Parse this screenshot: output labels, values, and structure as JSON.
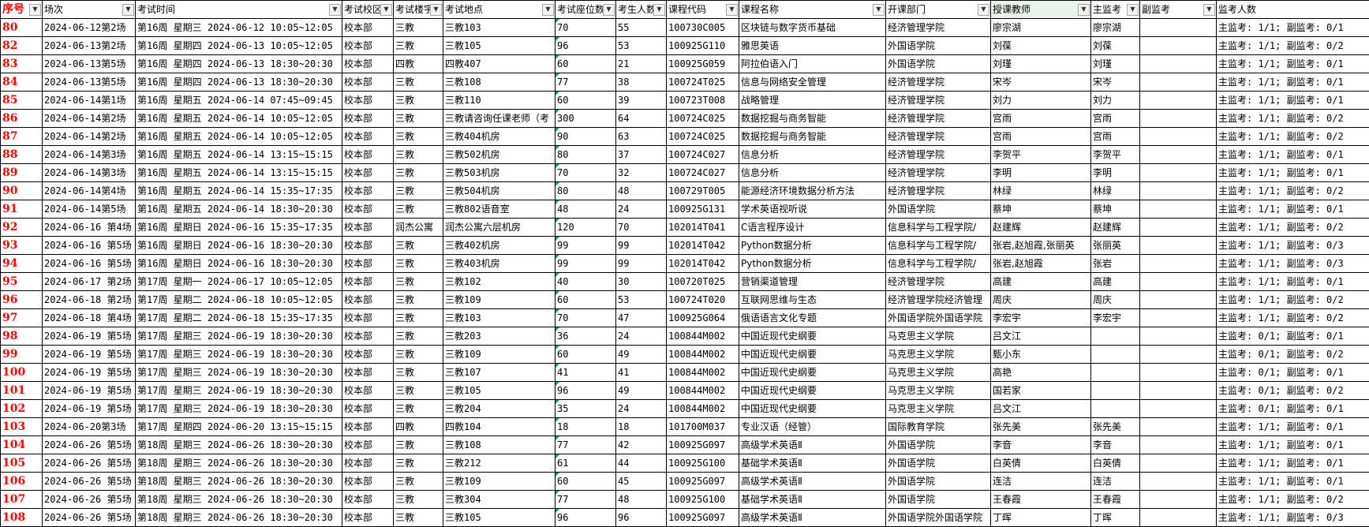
{
  "headers": [
    "序号",
    "场次",
    "考试时间",
    "考试校区",
    "考试楼宇",
    "考试地点",
    "考试座位数",
    "考生人数",
    "课程代码",
    "课程名称",
    "开课部门",
    "授课教师",
    "主监考",
    "副监考",
    "监考人数"
  ],
  "rows": [
    [
      "80",
      "2024-06-12第2场",
      "第16周 星期三 2024-06-12 10:05~12:05",
      "校本部",
      "三教",
      "三教103",
      "70",
      "55",
      "100730C005",
      "区块链与数字货币基础",
      "经济管理学院",
      "廖宗湖",
      "廖宗湖",
      "",
      "主监考: 1/1; 副监考: 0/1"
    ],
    [
      "82",
      "2024-06-13第2场",
      "第16周 星期四 2024-06-13 10:05~12:05",
      "校本部",
      "三教",
      "三教105",
      "96",
      "53",
      "100925G110",
      "雅思英语",
      "外国语学院",
      "刘葆",
      "刘葆",
      "",
      "主监考: 1/1; 副监考: 0/2"
    ],
    [
      "83",
      "2024-06-13第5场",
      "第16周 星期四 2024-06-13 18:30~20:30",
      "校本部",
      "四教",
      "四教407",
      "60",
      "21",
      "100925G059",
      "阿拉伯语入门",
      "外国语学院",
      "刘瑾",
      "刘瑾",
      "",
      "主监考: 1/1; 副监考: 0/1"
    ],
    [
      "84",
      "2024-06-13第5场",
      "第16周 星期四 2024-06-13 18:30~20:30",
      "校本部",
      "三教",
      "三教108",
      "77",
      "38",
      "100724T025",
      "信息与网络安全管理",
      "经济管理学院",
      "宋岑",
      "宋岑",
      "",
      "主监考: 1/1; 副监考: 0/1"
    ],
    [
      "85",
      "2024-06-14第1场",
      "第16周 星期五 2024-06-14 07:45~09:45",
      "校本部",
      "三教",
      "三教110",
      "60",
      "39",
      "100723T008",
      "战略管理",
      "经济管理学院",
      "刘力",
      "刘力",
      "",
      "主监考: 1/1; 副监考: 0/1"
    ],
    [
      "86",
      "2024-06-14第2场",
      "第16周 星期五 2024-06-14 10:05~12:05",
      "校本部",
      "三教",
      "三教请咨询任课老师（考",
      "300",
      "64",
      "100724C025",
      "数据挖掘与商务智能",
      "经济管理学院",
      "宫雨",
      "宫雨",
      "",
      "主监考: 1/1; 副监考: 0/2"
    ],
    [
      "87",
      "2024-06-14第2场",
      "第16周 星期五 2024-06-14 10:05~12:05",
      "校本部",
      "三教",
      "三教404机房",
      "90",
      "63",
      "100724C025",
      "数据挖掘与商务智能",
      "经济管理学院",
      "宫雨",
      "宫雨",
      "",
      "主监考: 1/1; 副监考: 0/2"
    ],
    [
      "88",
      "2024-06-14第3场",
      "第16周 星期五 2024-06-14 13:15~15:15",
      "校本部",
      "三教",
      "三教502机房",
      "80",
      "37",
      "100724C027",
      "信息分析",
      "经济管理学院",
      "李贺平",
      "李贺平",
      "",
      "主监考: 1/1; 副监考: 0/1"
    ],
    [
      "89",
      "2024-06-14第3场",
      "第16周 星期五 2024-06-14 13:15~15:15",
      "校本部",
      "三教",
      "三教503机房",
      "70",
      "32",
      "100724C027",
      "信息分析",
      "经济管理学院",
      "李明",
      "李明",
      "",
      "主监考: 1/1; 副监考: 0/1"
    ],
    [
      "90",
      "2024-06-14第4场",
      "第16周 星期五 2024-06-14 15:35~17:35",
      "校本部",
      "三教",
      "三教504机房",
      "80",
      "48",
      "100729T005",
      "能源经济环境数据分析方法",
      "经济管理学院",
      "林绿",
      "林绿",
      "",
      "主监考: 1/1; 副监考: 0/2"
    ],
    [
      "91",
      "2024-06-14第5场",
      "第16周 星期五 2024-06-14 18:30~20:30",
      "校本部",
      "三教",
      "三教802语音室",
      "48",
      "24",
      "100925G131",
      "学术英语视听说",
      "外国语学院",
      "蔡坤",
      "蔡坤",
      "",
      "主监考: 1/1; 副监考: 0/1"
    ],
    [
      "92",
      "2024-06-16 第4场",
      "第16周 星期日 2024-06-16 15:35~17:35",
      "校本部",
      "润杰公寓",
      "润杰公寓六层机房",
      "120",
      "70",
      "102014T041",
      "C语言程序设计",
      "信息科学与工程学院/",
      "赵建辉",
      "赵建辉",
      "",
      "主监考: 1/1; 副监考: 0/2"
    ],
    [
      "93",
      "2024-06-16 第5场",
      "第16周 星期日 2024-06-16 18:30~20:30",
      "校本部",
      "三教",
      "三教402机房",
      "99",
      "99",
      "102014T042",
      "Python数据分析",
      "信息科学与工程学院/",
      "张岩,赵旭霞,张丽英",
      "张丽英",
      "",
      "主监考: 1/1; 副监考: 0/3"
    ],
    [
      "94",
      "2024-06-16 第5场",
      "第16周 星期日 2024-06-16 18:30~20:30",
      "校本部",
      "三教",
      "三教403机房",
      "99",
      "99",
      "102014T042",
      "Python数据分析",
      "信息科学与工程学院/",
      "张岩,赵旭霞",
      "张岩",
      "",
      "主监考: 1/1; 副监考: 0/3"
    ],
    [
      "95",
      "2024-06-17 第2场",
      "第17周 星期一 2024-06-17 10:05~12:05",
      "校本部",
      "三教",
      "三教102",
      "40",
      "30",
      "100720T025",
      "营销渠道管理",
      "经济管理学院",
      "高建",
      "高建",
      "",
      "主监考: 1/1; 副监考: 0/1"
    ],
    [
      "96",
      "2024-06-18 第2场",
      "第17周 星期二 2024-06-18 10:05~12:05",
      "校本部",
      "三教",
      "三教109",
      "60",
      "53",
      "100724T020",
      "互联网思维与生态",
      "经济管理学院经济管理",
      "周庆",
      "周庆",
      "",
      "主监考: 1/1; 副监考: 0/2"
    ],
    [
      "97",
      "2024-06-18 第4场",
      "第17周 星期二 2024-06-18 15:35~17:35",
      "校本部",
      "三教",
      "三教103",
      "70",
      "47",
      "100925G064",
      "俄语语言文化专题",
      "外国语学院外国语学院",
      "李宏宇",
      "李宏宇",
      "",
      "主监考: 1/1; 副监考: 0/2"
    ],
    [
      "98",
      "2024-06-19 第5场",
      "第17周 星期三 2024-06-19 18:30~20:30",
      "校本部",
      "三教",
      "三教203",
      "36",
      "24",
      "100844M002",
      "中国近现代史纲要",
      "马克思主义学院",
      "吕文江",
      "",
      "",
      "主监考: 0/1; 副监考: 0/1"
    ],
    [
      "99",
      "2024-06-19 第5场",
      "第17周 星期三 2024-06-19 18:30~20:30",
      "校本部",
      "三教",
      "三教109",
      "60",
      "49",
      "100844M002",
      "中国近现代史纲要",
      "马克思主义学院",
      "甄小东",
      "",
      "",
      "主监考: 0/1; 副监考: 0/2"
    ],
    [
      "100",
      "2024-06-19 第5场",
      "第17周 星期三 2024-06-19 18:30~20:30",
      "校本部",
      "三教",
      "三教107",
      "41",
      "41",
      "100844M002",
      "中国近现代史纲要",
      "马克思主义学院",
      "高艳",
      "",
      "",
      "主监考: 0/1; 副监考: 0/1"
    ],
    [
      "101",
      "2024-06-19 第5场",
      "第17周 星期三 2024-06-19 18:30~20:30",
      "校本部",
      "三教",
      "三教105",
      "96",
      "49",
      "100844M002",
      "中国近现代史纲要",
      "马克思主义学院",
      "国若家",
      "",
      "",
      "主监考: 0/1; 副监考: 0/2"
    ],
    [
      "102",
      "2024-06-19 第5场",
      "第17周 星期三 2024-06-19 18:30~20:30",
      "校本部",
      "三教",
      "三教204",
      "35",
      "24",
      "100844M002",
      "中国近现代史纲要",
      "马克思主义学院",
      "吕文江",
      "",
      "",
      "主监考: 0/1; 副监考: 0/1"
    ],
    [
      "103",
      "2024-06-20第3场",
      "第17周 星期四 2024-06-20 13:15~15:15",
      "校本部",
      "四教",
      "四教104",
      "18",
      "18",
      "101700M037",
      "专业汉语（经管）",
      "国际教育学院",
      "张先美",
      "张先美",
      "",
      "主监考: 1/1; 副监考: 0/1"
    ],
    [
      "104",
      "2024-06-26 第5场",
      "第18周 星期三 2024-06-26 18:30~20:30",
      "校本部",
      "三教",
      "三教108",
      "77",
      "42",
      "100925G097",
      "高级学术英语Ⅱ",
      "外国语学院",
      "李音",
      "李音",
      "",
      "主监考: 1/1; 副监考: 0/1"
    ],
    [
      "105",
      "2024-06-26 第5场",
      "第18周 星期三 2024-06-26 18:30~20:30",
      "校本部",
      "三教",
      "三教212",
      "61",
      "44",
      "100925G100",
      "基础学术英语Ⅱ",
      "外国语学院",
      "白英倩",
      "白英倩",
      "",
      "主监考: 1/1; 副监考: 0/1"
    ],
    [
      "106",
      "2024-06-26 第5场",
      "第18周 星期三 2024-06-26 18:30~20:30",
      "校本部",
      "三教",
      "三教109",
      "60",
      "45",
      "100925G097",
      "高级学术英语Ⅱ",
      "外国语学院",
      "连洁",
      "连洁",
      "",
      "主监考: 1/1; 副监考: 0/1"
    ],
    [
      "107",
      "2024-06-26 第5场",
      "第18周 星期三 2024-06-26 18:30~20:30",
      "校本部",
      "三教",
      "三教304",
      "77",
      "48",
      "100925G100",
      "基础学术英语Ⅱ",
      "外国语学院",
      "王春霞",
      "王春霞",
      "",
      "主监考: 1/1; 副监考: 0/2"
    ],
    [
      "108",
      "2024-06-26 第5场",
      "第18周 星期三 2024-06-26 18:30~20:30",
      "校本部",
      "三教",
      "三教105",
      "96",
      "96",
      "100925G097",
      "高级学术英语Ⅱ",
      "外国语学院外国语学院",
      "丁晖",
      "丁晖",
      "",
      "主监考: 1/1; 副监考: 0/3"
    ]
  ]
}
